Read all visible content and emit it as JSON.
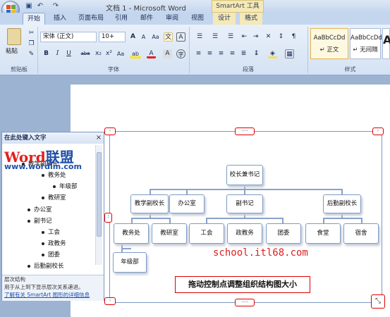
{
  "window": {
    "title": "文档 1 - Microsoft Word",
    "context_tab_group": "SmartArt 工具"
  },
  "tabs": [
    "开始",
    "插入",
    "页面布局",
    "引用",
    "邮件",
    "审阅",
    "视图",
    "设计",
    "格式"
  ],
  "ribbon": {
    "clipboard": {
      "paste": "粘贴",
      "label": "剪贴板"
    },
    "font": {
      "name": "宋体 (正文)",
      "size": "10+",
      "label": "字体",
      "grow": "A",
      "shrink": "A",
      "clear": "Aa",
      "bold": "B",
      "italic": "I",
      "underline": "U",
      "strike": "abe",
      "sub": "x₂",
      "sup": "x²",
      "case": "Aa",
      "highlight": "ab",
      "color": "A",
      "charborder": "A"
    },
    "paragraph": {
      "label": "段落"
    },
    "styles": {
      "label": "样式",
      "items": [
        {
          "sample": "AaBbCcDd",
          "name": "↵ 正文"
        },
        {
          "sample": "AaBbCcDd",
          "name": "↵ 无间隔"
        },
        {
          "sample": "A",
          "name": ""
        }
      ]
    }
  },
  "text_pane": {
    "title": "在此处键入文字",
    "close": "×",
    "items": [
      {
        "text": "教学副校长",
        "level": 1
      },
      {
        "text": "教务处",
        "level": 2
      },
      {
        "text": "年级部",
        "level": 3
      },
      {
        "text": "教研室",
        "level": 2
      },
      {
        "text": "办公室",
        "level": 1
      },
      {
        "text": "副书记",
        "level": 1
      },
      {
        "text": "工会",
        "level": 2
      },
      {
        "text": "政教务",
        "level": 2
      },
      {
        "text": "团委",
        "level": 2
      },
      {
        "text": "后勤副校长",
        "level": 1
      }
    ],
    "footer": [
      "层次结构",
      "用于从上到下显示层次关系递进。"
    ],
    "footer_link": "了解有关 SmartArt 图形的详细信息"
  },
  "watermark": {
    "brand1": "Word",
    "brand2": "联盟",
    "url": "www.wordlm.com"
  },
  "org_chart": {
    "root": "校长兼书记",
    "level1": [
      "教学副校长",
      "办公室",
      "副书记",
      "后勤副校长"
    ],
    "level2": [
      "教务处",
      "教研室",
      "工会",
      "政教务",
      "团委",
      "食堂",
      "宿舍"
    ],
    "level3": [
      "年级部"
    ]
  },
  "handles": {
    "top_center": "····",
    "bottom_center": "····",
    "resize": "⤡"
  },
  "overlay": {
    "site": "school.itl68.com",
    "caption": "拖动控制点调整组织结构图大小"
  }
}
